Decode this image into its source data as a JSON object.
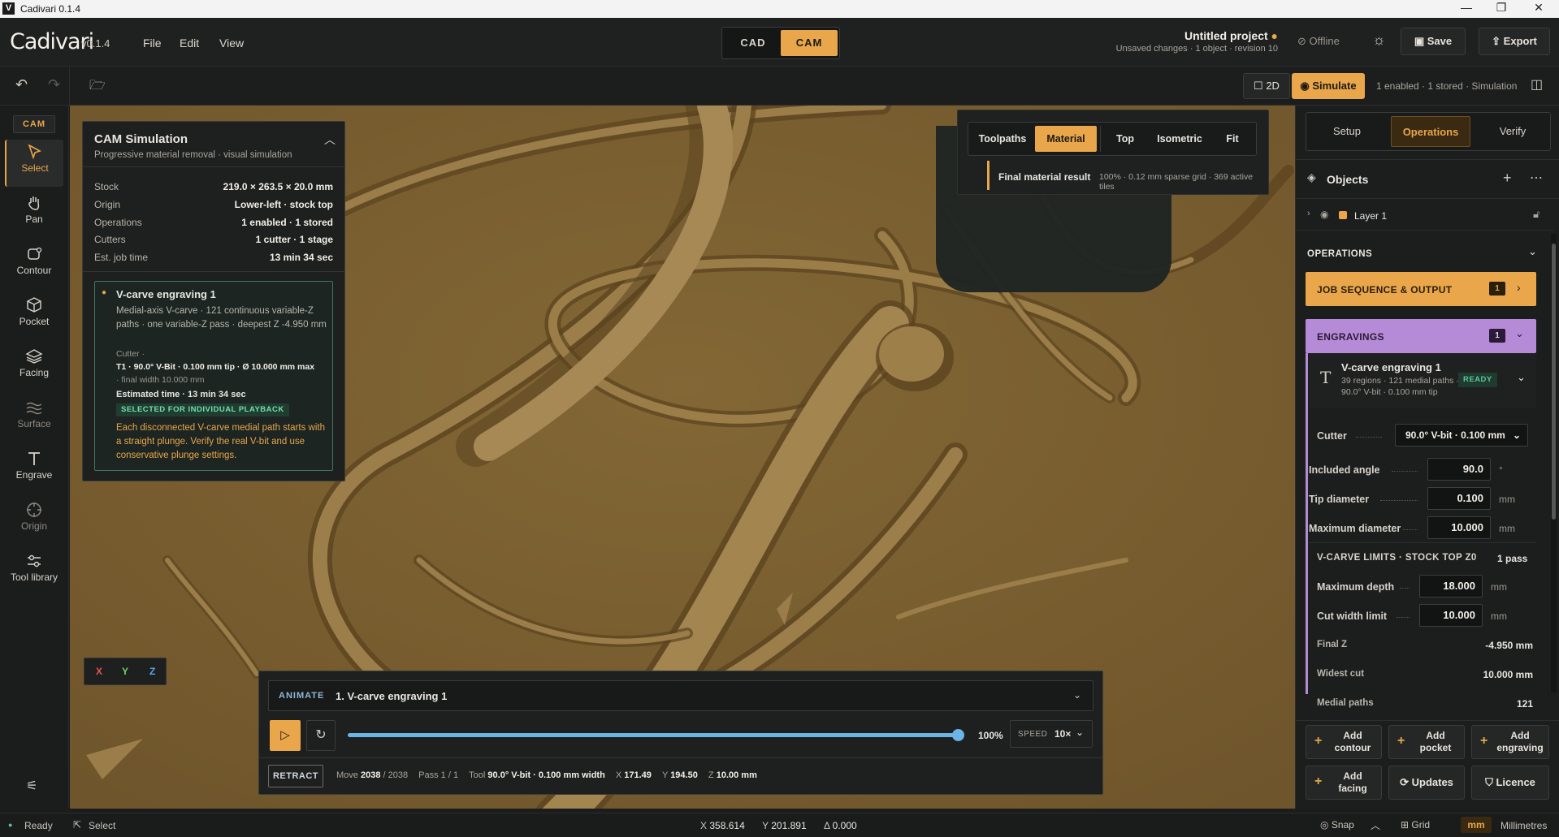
{
  "window": {
    "title": "Cadivari 0.1.4",
    "logo": "V"
  },
  "app": {
    "brand": "Cadivari",
    "version": "v0.1.4",
    "menus": [
      "File",
      "Edit",
      "View"
    ],
    "modes": [
      "CAD",
      "CAM"
    ],
    "active_mode": "CAM",
    "project_title": "Untitled project",
    "project_sub": "Unsaved changes · 1 object · revision 10",
    "offline": "Offline",
    "save": "Save",
    "export": "Export"
  },
  "toolbar": {
    "view2d": "2D",
    "simulate": "Simulate",
    "summary": "1 enabled · 1 stored · Simulation"
  },
  "rail": {
    "badge": "CAM",
    "tools": [
      "Select",
      "Pan",
      "Contour",
      "Pocket",
      "Facing",
      "Surface",
      "Engrave",
      "Origin",
      "Tool library"
    ]
  },
  "viewtabs": {
    "items": [
      "Toolpaths",
      "Material",
      "Top",
      "Isometric",
      "Fit"
    ],
    "active": "Material",
    "result_label": "Final material result",
    "result_info": "100% · 0.12 mm sparse grid · 369 active tiles"
  },
  "sim": {
    "title": "CAM Simulation",
    "subtitle": "Progressive material removal · visual simulation",
    "rows": [
      {
        "k": "Stock",
        "v": "219.0 × 263.5 × 20.0 mm"
      },
      {
        "k": "Origin",
        "v": "Lower-left · stock top"
      },
      {
        "k": "Operations",
        "v": "1 enabled · 1 stored"
      },
      {
        "k": "Cutters",
        "v": "1 cutter · 1 stage"
      },
      {
        "k": "Est. job time",
        "v": "13 min 34 sec"
      }
    ],
    "op_title": "V-carve engraving 1",
    "op_desc": "Medial-axis V-carve · 121 continuous variable-Z paths · one variable-Z pass · deepest Z -4.950 mm",
    "cutter_label": "Cutter ·",
    "cutter_value": "T1 · 90.0° V-Bit · 0.100 mm tip · Ø 10.000 mm max",
    "cutter_extra": "· final width 10.000 mm",
    "time": "Estimated time · 13 min 34 sec",
    "badge": "SELECTED FOR INDIVIDUAL PLAYBACK",
    "note": "Each disconnected V-carve medial path starts with a straight plunge. Verify the real V-bit and use conservative plunge settings."
  },
  "axes": [
    "X",
    "Y",
    "Z"
  ],
  "anim": {
    "label": "ANIMATE",
    "op": "1. V-carve engraving 1",
    "progress": 1.0,
    "percent": "100%",
    "speed_label": "SPEED",
    "speed": "10×",
    "retract": "RETRACT",
    "move_label": "Move",
    "move": "2038",
    "move_total": "/ 2038",
    "pass": "Pass 1 / 1",
    "tool_label": "Tool",
    "tool": "90.0° V-bit · 0.100 mm width",
    "x_label": "X",
    "x": "171.49",
    "y_label": "Y",
    "y": "194.50",
    "z_label": "Z",
    "z": "10.00 mm"
  },
  "right": {
    "tabs": [
      "Setup",
      "Operations",
      "Verify"
    ],
    "active": "Operations",
    "objects": "Objects",
    "layer": "Layer 1",
    "operations_head": "OPERATIONS",
    "job": "JOB SEQUENCE & OUTPUT",
    "job_count": "1",
    "engr": "ENGRAVINGS",
    "engr_count": "1",
    "op_name": "V-carve engraving 1",
    "op_meta1": "39 regions · 121 medial paths ·",
    "op_meta2": "90.0° V-bit · 0.100 mm tip",
    "op_status": "READY",
    "cutter_label": "Cutter",
    "cutter_value": "90.0° V-bit · 0.100 mm",
    "fields": [
      {
        "k": "Included angle",
        "v": "90.0",
        "u": "°"
      },
      {
        "k": "Tip diameter",
        "v": "0.100",
        "u": "mm"
      },
      {
        "k": "Maximum diameter",
        "v": "10.000",
        "u": "mm"
      }
    ],
    "limits_head": "V-CARVE LIMITS · STOCK TOP Z0",
    "limits_pass": "1 pass",
    "limits": [
      {
        "k": "Maximum depth",
        "v": "18.000",
        "u": "mm"
      },
      {
        "k": "Cut width limit",
        "v": "10.000",
        "u": "mm"
      }
    ],
    "readouts": [
      {
        "k": "Final Z",
        "v": "-4.950 mm"
      },
      {
        "k": "Widest cut",
        "v": "10.000 mm"
      },
      {
        "k": "Medial paths",
        "v": "121"
      }
    ],
    "add": [
      {
        "l1": "Add",
        "l2": "contour"
      },
      {
        "l1": "Add",
        "l2": "pocket"
      },
      {
        "l1": "Add",
        "l2": "engraving"
      },
      {
        "l1": "Add",
        "l2": "facing"
      }
    ],
    "updates": "Updates",
    "licence": "Licence"
  },
  "status": {
    "state": "Ready",
    "tool": "Select",
    "x_label": "X",
    "x": "358.614",
    "y_label": "Y",
    "y": "201.891",
    "d_label": "Δ",
    "d": "0.000",
    "snap": "Snap",
    "grid": "Grid",
    "unit": "mm",
    "unit_full": "Millimetres"
  },
  "colors": {
    "accent": "#e9a64a",
    "engrave": "#b58ad6",
    "wood": "#7b6030",
    "ready": "#5bc79a"
  }
}
